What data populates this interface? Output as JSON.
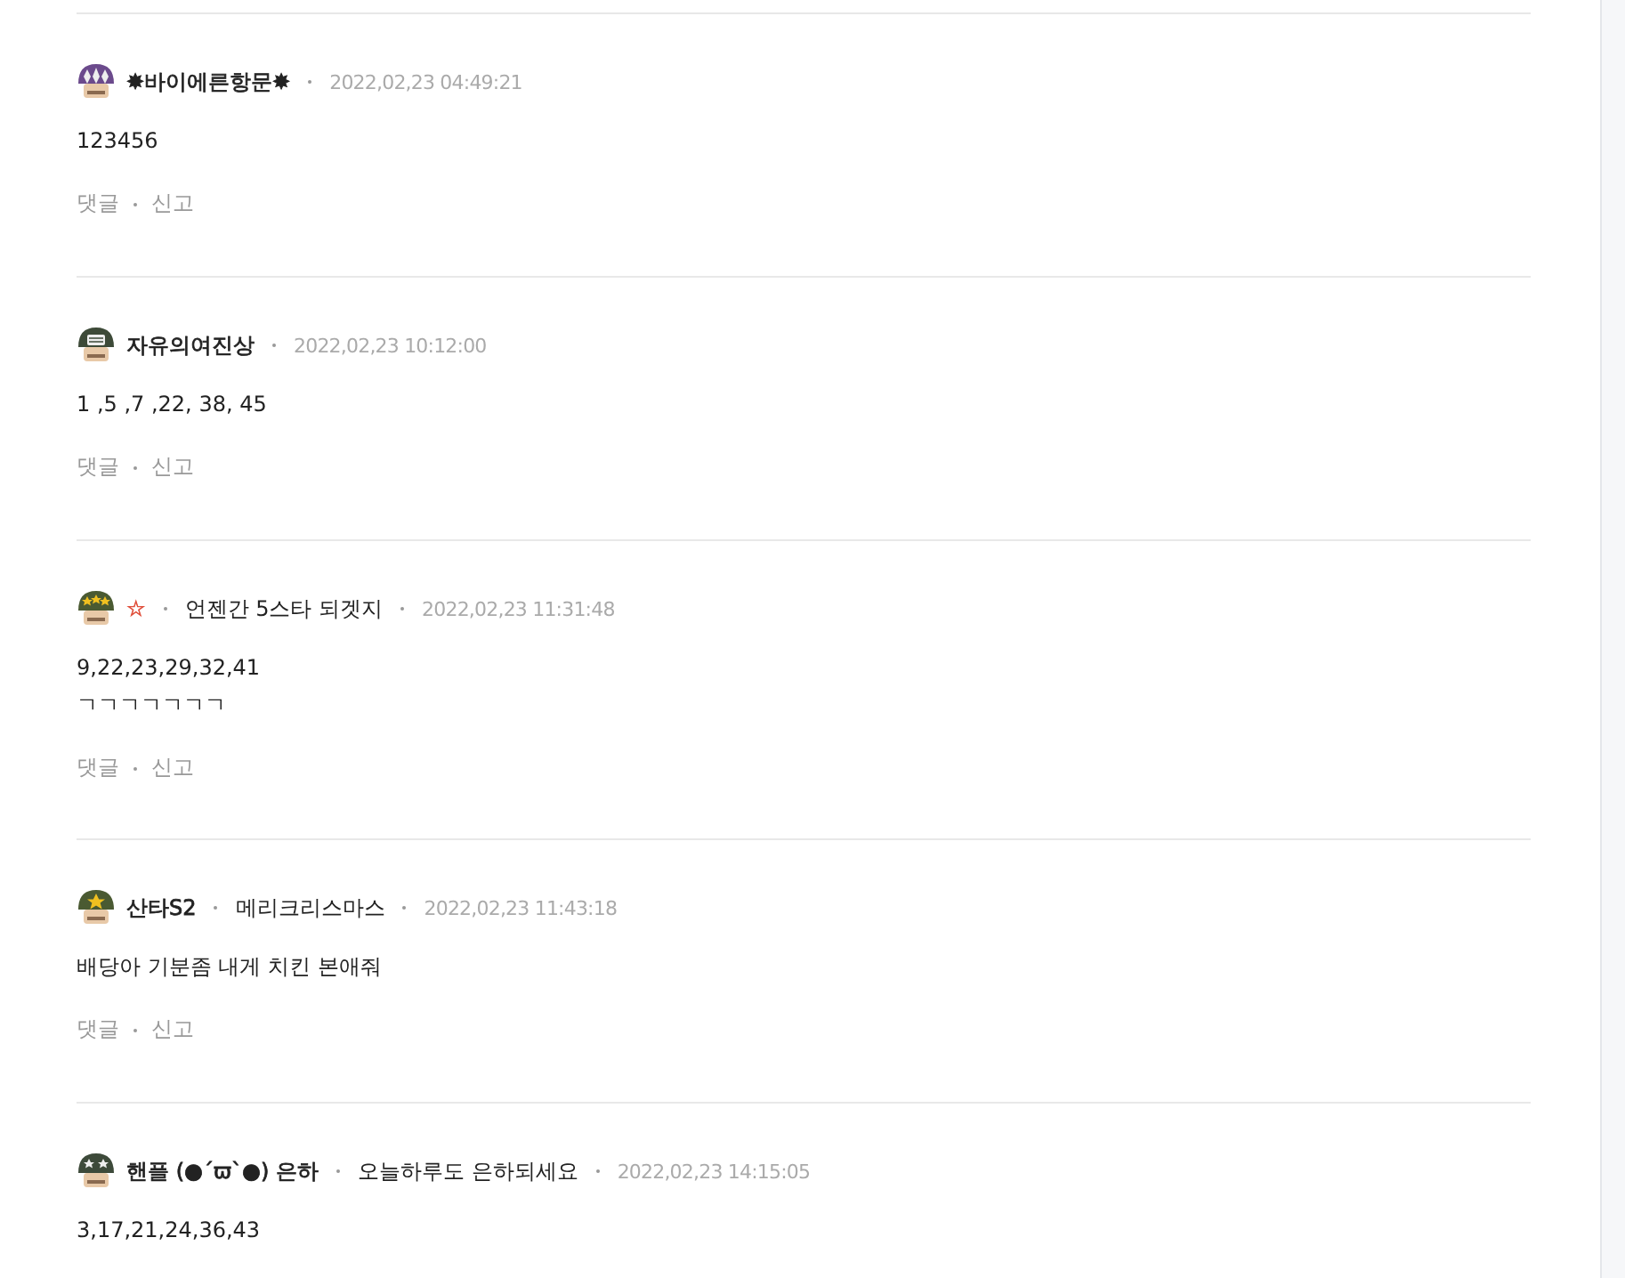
{
  "comments": [
    {
      "kind": "diamonds",
      "name": "✸바이에른항문✸",
      "color": "#222222",
      "date": "2022,02,23 04:49:21",
      "body": [
        "123456"
      ],
      "actions": [
        "댓글",
        "신고"
      ]
    },
    {
      "kind": "stripes",
      "name": "자유의여진상",
      "color": "#222222",
      "date": "2022,02,23 10:12:00",
      "body": [
        "1 ,5 ,7 ,22, 38, 45"
      ],
      "actions": [
        "댓글",
        "신고"
      ]
    },
    {
      "kind": "stars",
      "name": "☆",
      "color": "#e0503c",
      "motto": "언젠간 5스타 되겟지",
      "date": "2022,02,23 11:31:48",
      "body": [
        "9,22,23,29,32,41",
        "ㄱㄱㄱㄱㄱㄱㄱ"
      ],
      "actions": [
        "댓글",
        "신고"
      ]
    },
    {
      "kind": "star",
      "name": "산타S2",
      "color": "#222222",
      "motto": "메리크리스마스",
      "date": "2022,02,23 11:43:18",
      "body": [
        "배당아 기분좀 내게 치킨 본애줘"
      ],
      "actions": [
        "댓글",
        "신고"
      ]
    },
    {
      "kind": "twostars",
      "name": "핸플 (●´ϖ`●) 은하",
      "color": "#222222",
      "motto": "오늘하루도 은하되세요",
      "date": "2022,02,23 14:15:05",
      "body": [
        "3,17,21,24,36,43"
      ]
    }
  ]
}
